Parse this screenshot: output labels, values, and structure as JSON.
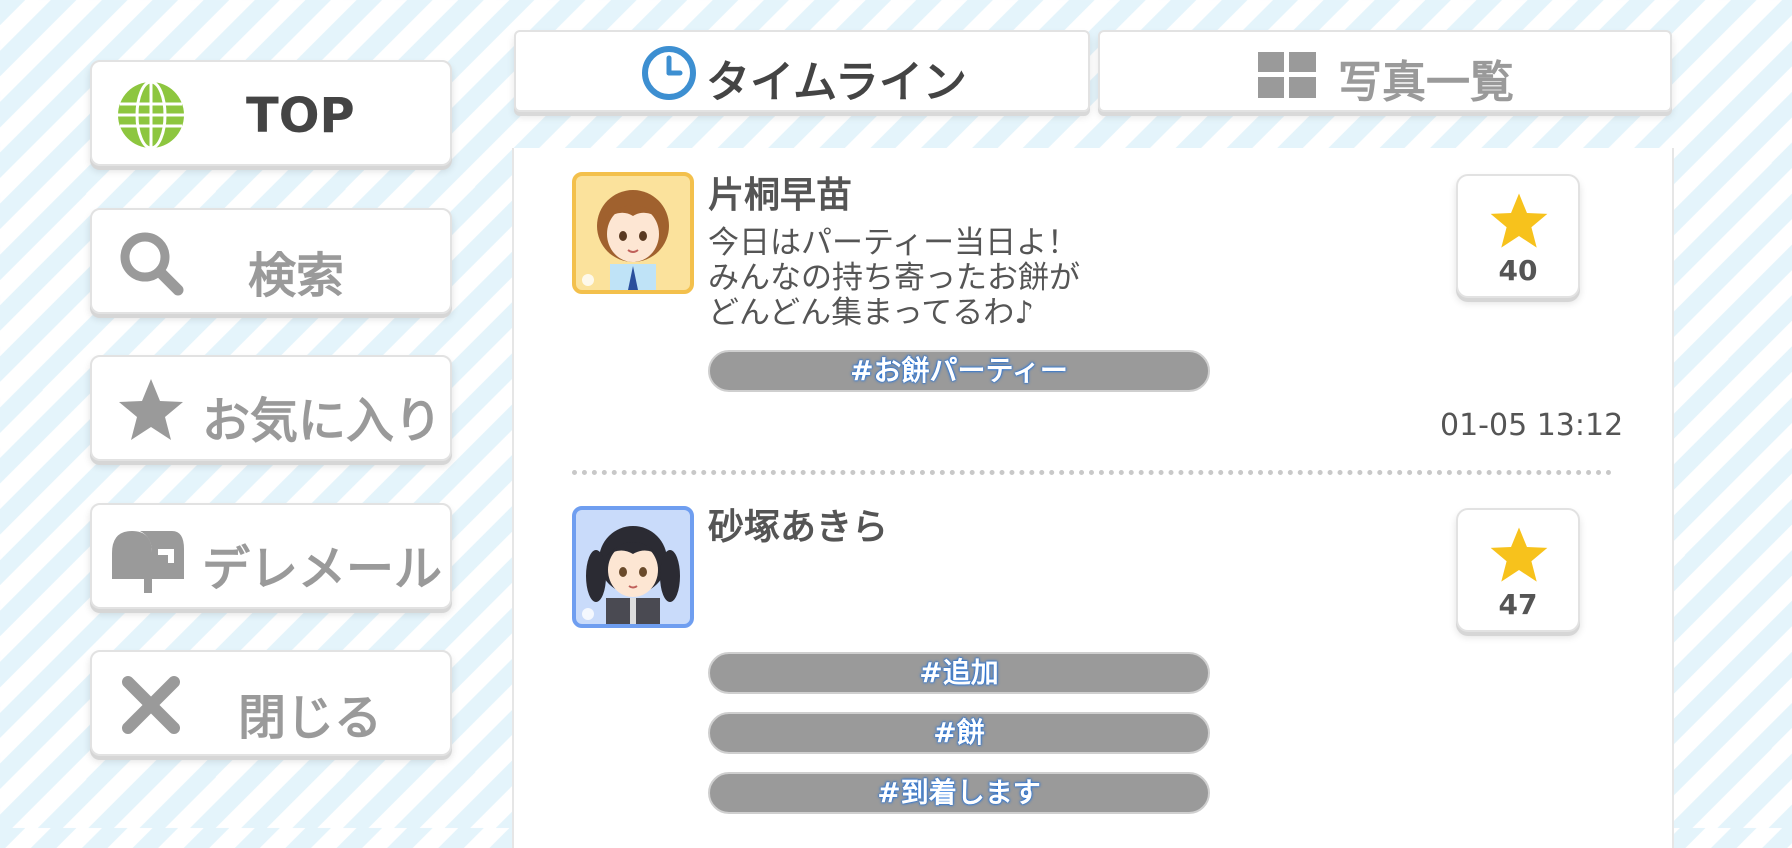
{
  "nav": {
    "top_label": "TOP",
    "search_label": "検索",
    "favorites_label": "お気に入り",
    "mail_label": "デレメール",
    "close_label": "閉じる"
  },
  "tabs": {
    "timeline_label": "タイムライン",
    "photos_label": "写真一覧"
  },
  "posts": [
    {
      "name": "片桐早苗",
      "text": "今日はパーティー当日よ！\nみんなの持ち寄ったお餅が\nどんどん集まってるわ♪",
      "tags": [
        "#お餅パーティー"
      ],
      "likes": "40",
      "time": "01-05 13:12"
    },
    {
      "name": "砂塚あきら",
      "text": "",
      "tags": [
        "#追加",
        "#餅",
        "#到着します"
      ],
      "likes": "47"
    }
  ],
  "colors": {
    "accent_blue": "#3d8fd1",
    "globe_green": "#8dc63f",
    "star_yellow": "#f7c21c",
    "tag_gray": "#9a9a9a"
  },
  "icons": [
    "globe-icon",
    "search-icon",
    "star-icon",
    "mailbox-icon",
    "close-icon",
    "clock-icon",
    "grid-icon"
  ]
}
